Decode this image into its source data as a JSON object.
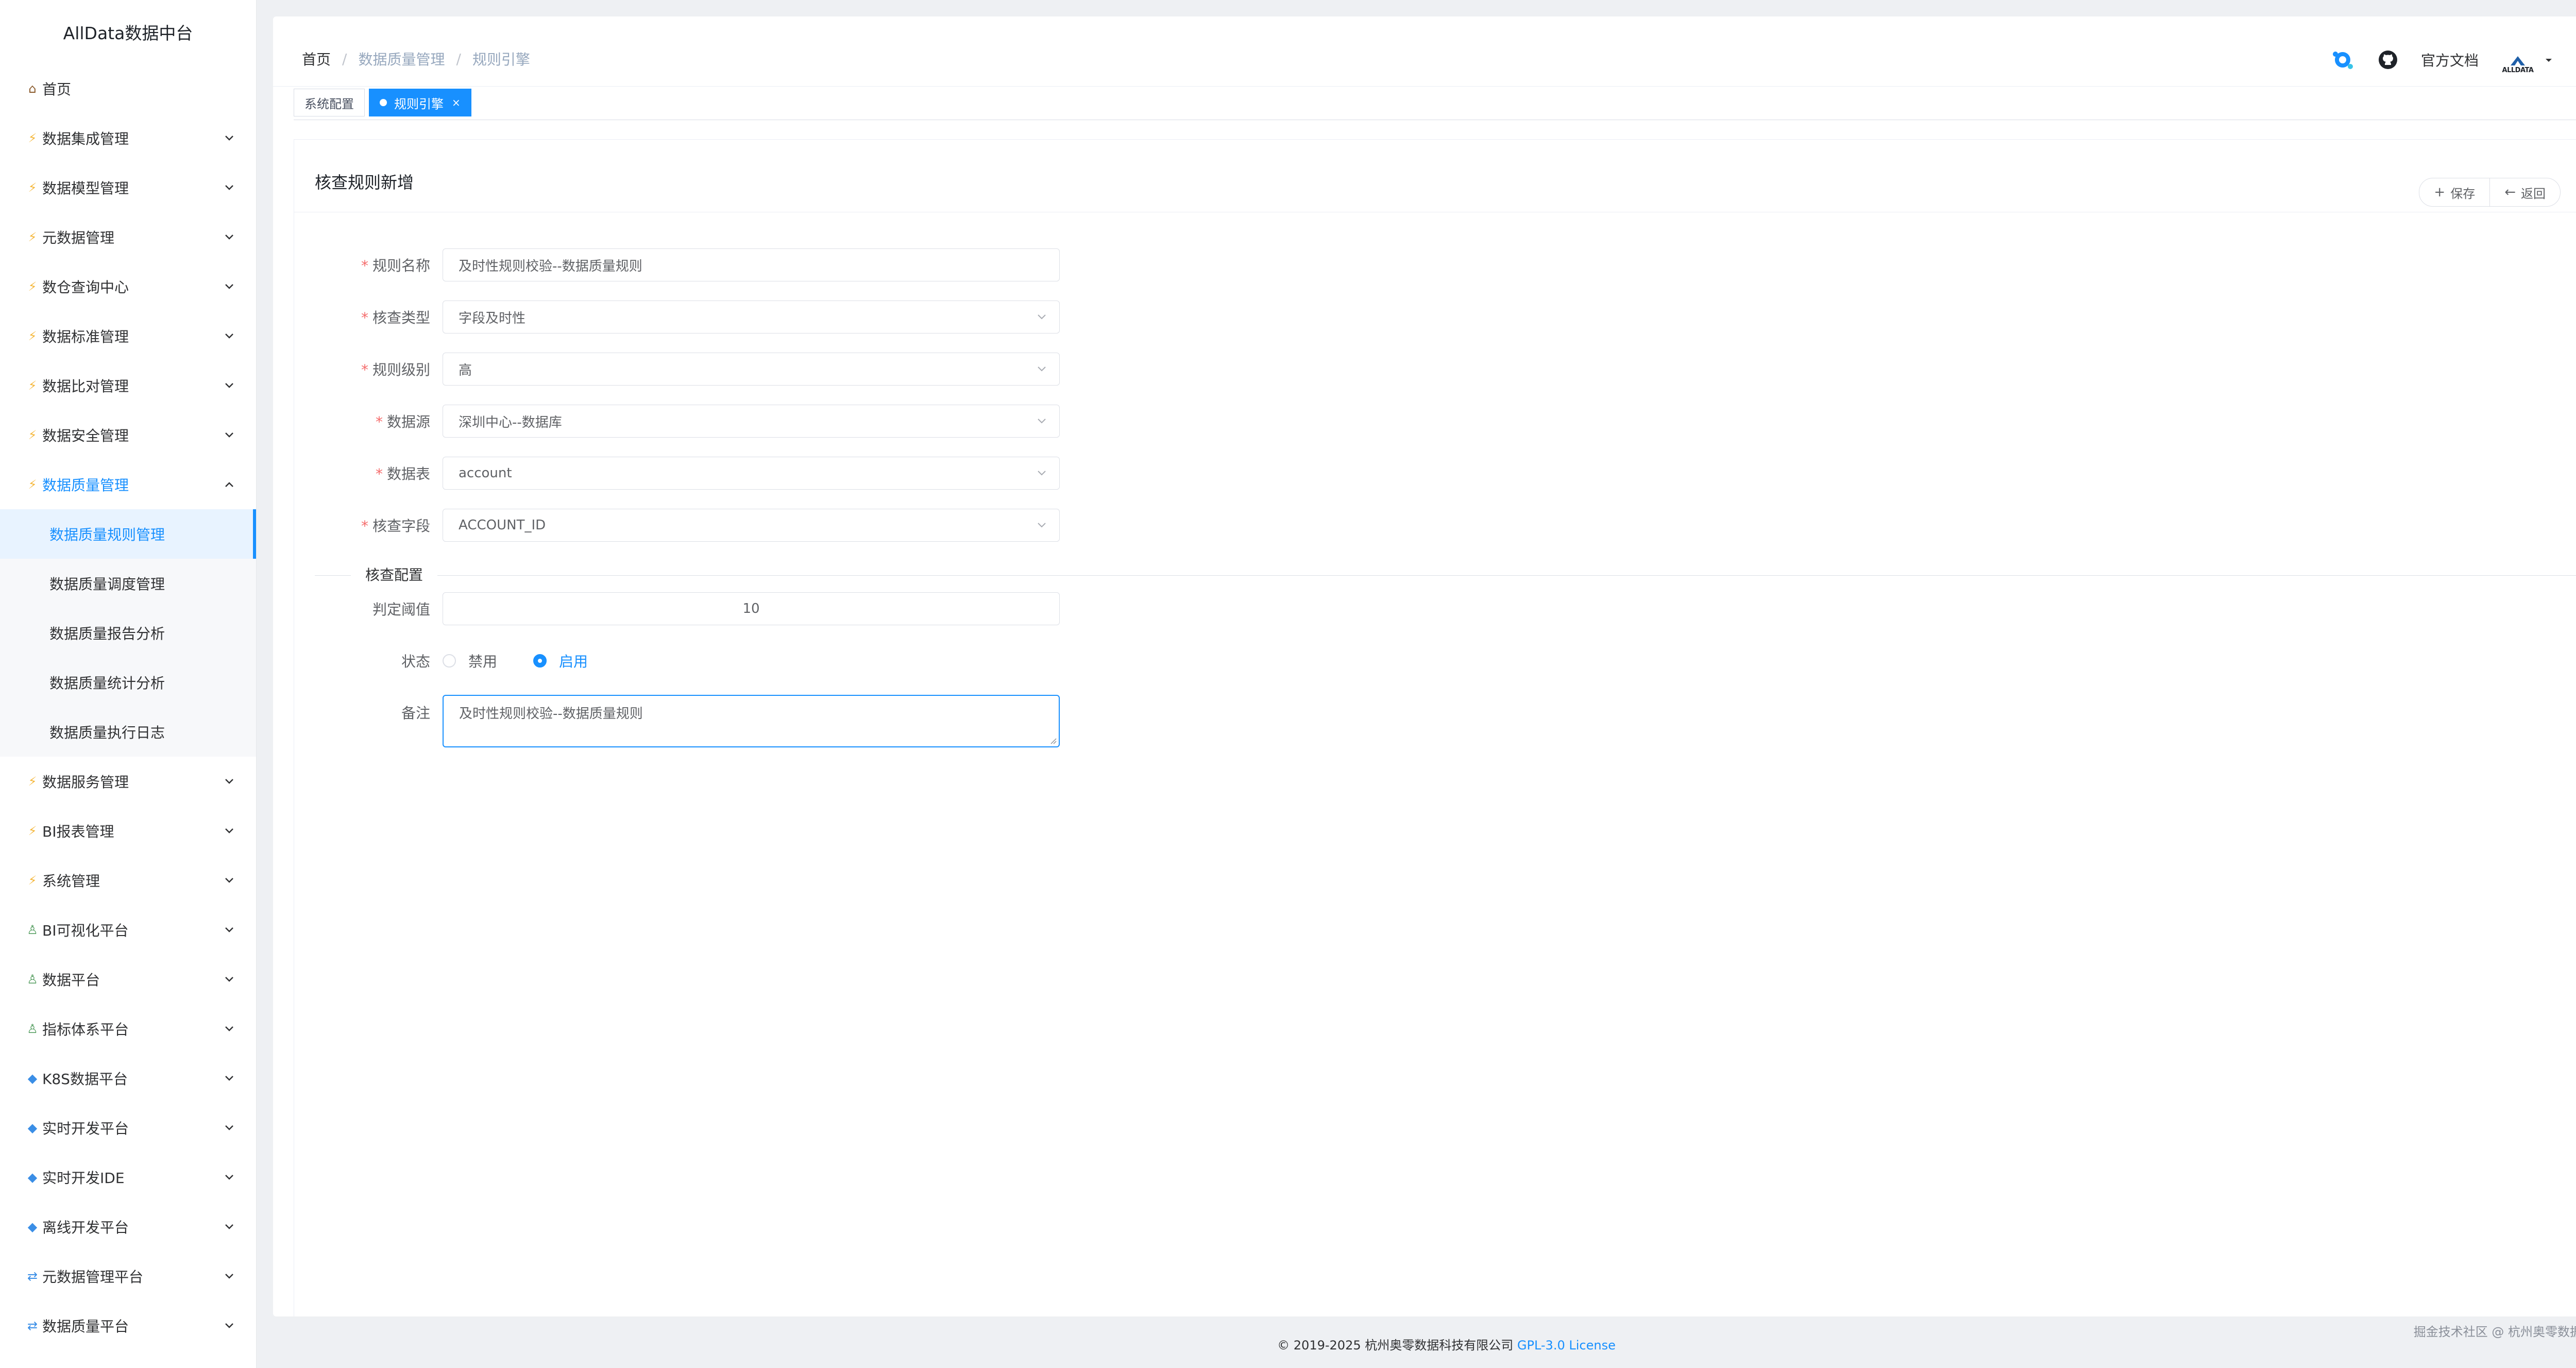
{
  "sidebar": {
    "logo": "AllData数据中台",
    "items": [
      {
        "label": "首页",
        "icon": "home-icon"
      },
      {
        "label": "数据集成管理",
        "icon": "bolt-icon"
      },
      {
        "label": "数据模型管理",
        "icon": "bolt-icon"
      },
      {
        "label": "元数据管理",
        "icon": "bolt-icon"
      },
      {
        "label": "数仓查询中心",
        "icon": "bolt-icon"
      },
      {
        "label": "数据标准管理",
        "icon": "bolt-icon"
      },
      {
        "label": "数据比对管理",
        "icon": "bolt-icon"
      },
      {
        "label": "数据安全管理",
        "icon": "bolt-icon"
      },
      {
        "label": "数据质量管理",
        "icon": "bolt-icon"
      },
      {
        "label": "数据服务管理",
        "icon": "bolt-icon"
      },
      {
        "label": "BI报表管理",
        "icon": "bolt-icon"
      },
      {
        "label": "系统管理",
        "icon": "bolt-icon"
      },
      {
        "label": "BI可视化平台",
        "icon": "person-icon"
      },
      {
        "label": "数据平台",
        "icon": "person-icon"
      },
      {
        "label": "指标体系平台",
        "icon": "person-icon"
      },
      {
        "label": "K8S数据平台",
        "icon": "gem-icon"
      },
      {
        "label": "实时开发平台",
        "icon": "gem-icon"
      },
      {
        "label": "实时开发IDE",
        "icon": "gem-icon"
      },
      {
        "label": "离线开发平台",
        "icon": "gem-icon"
      },
      {
        "label": "元数据管理平台",
        "icon": "sync-icon"
      },
      {
        "label": "数据质量平台",
        "icon": "sync-icon"
      }
    ],
    "subitems": [
      {
        "label": "数据质量规则管理"
      },
      {
        "label": "数据质量调度管理"
      },
      {
        "label": "数据质量报告分析"
      },
      {
        "label": "数据质量统计分析"
      },
      {
        "label": "数据质量执行日志"
      }
    ]
  },
  "header": {
    "breadcrumb": [
      "首页",
      "数据质量管理",
      "规则引擎"
    ],
    "docs": "官方文档",
    "avatar_text": "ALLDATA"
  },
  "tabs": [
    {
      "label": "系统配置"
    },
    {
      "label": "规则引擎"
    }
  ],
  "panel": {
    "title": "核查规则新增",
    "save": "保存",
    "back": "返回"
  },
  "form": {
    "rule_name": {
      "label": "规则名称",
      "value": "及时性规则校验--数据质量规则"
    },
    "check_type": {
      "label": "核查类型",
      "value": "字段及时性"
    },
    "rule_level": {
      "label": "规则级别",
      "value": "高"
    },
    "datasource": {
      "label": "数据源",
      "value": "深圳中心--数据库"
    },
    "table": {
      "label": "数据表",
      "value": "account"
    },
    "field": {
      "label": "核查字段",
      "value": "ACCOUNT_ID"
    },
    "section": "核查配置",
    "threshold": {
      "label": "判定阈值",
      "value": "10"
    },
    "status": {
      "label": "状态",
      "options": [
        "禁用",
        "启用"
      ],
      "selected": "启用"
    },
    "remark": {
      "label": "备注",
      "value": "及时性规则校验--数据质量规则"
    }
  },
  "footer": {
    "copyright": "© 2019-2025 杭州奥零数据科技有限公司",
    "license": "GPL-3.0 License",
    "watermark": "掘金技术社区 @ 杭州奥零数据科技"
  },
  "colors": {
    "accent": "#1890ff",
    "required": "#f56c6c"
  }
}
